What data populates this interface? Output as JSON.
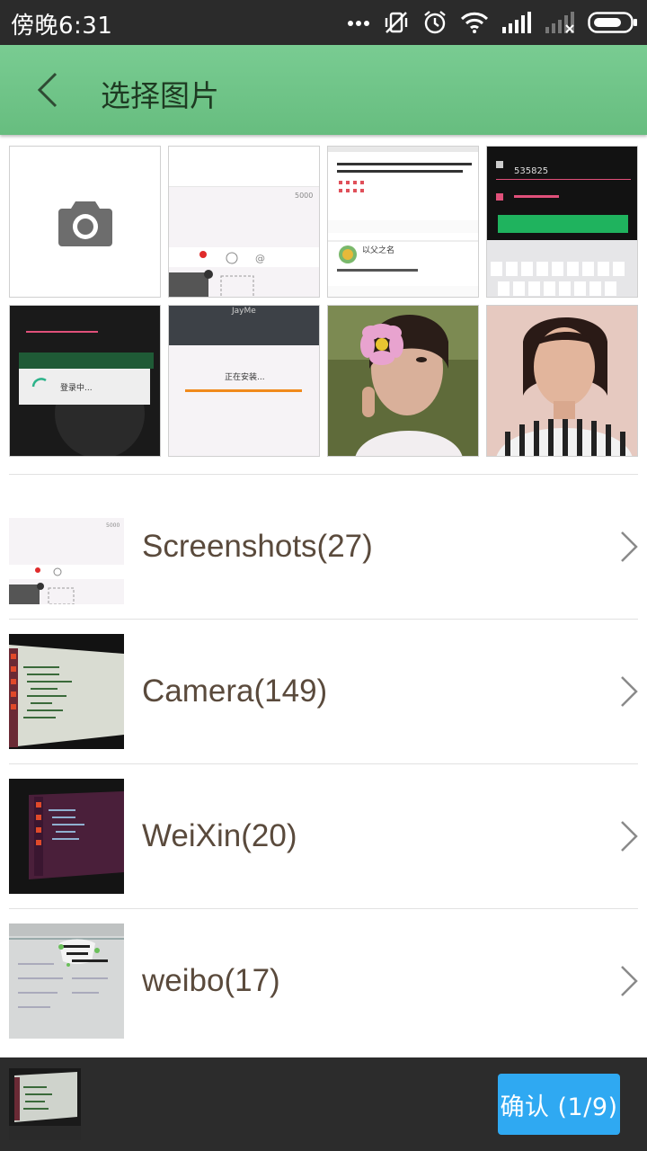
{
  "status_bar": {
    "time": "傍晚6:31",
    "icons": [
      "more-dots-icon",
      "vibrate-off-icon",
      "alarm-icon",
      "wifi-icon",
      "signal-icon",
      "signal-off-icon",
      "battery-icon"
    ]
  },
  "header": {
    "title": "选择图片",
    "back_icon": "chevron-left-icon",
    "background": "#6dc287"
  },
  "grid": {
    "camera_icon": "camera-icon",
    "thumbnails": [
      {
        "kind": "screenshot-compose",
        "text": "5000"
      },
      {
        "kind": "screenshot-feed",
        "text": "以父之名"
      },
      {
        "kind": "screenshot-keyboard",
        "text": "535825"
      },
      {
        "kind": "screenshot-loading",
        "text": "登录中..."
      },
      {
        "kind": "screenshot-install",
        "text": "正在安装...",
        "header": "JayMe"
      },
      {
        "kind": "photo-flower"
      },
      {
        "kind": "photo-portrait"
      }
    ]
  },
  "albums": [
    {
      "name": "Screenshots(27)"
    },
    {
      "name": "Camera(149)"
    },
    {
      "name": "WeiXin(20)"
    },
    {
      "name": "weibo(17)"
    }
  ],
  "bottom": {
    "confirm_label": "确认 (1/9)",
    "accent": "#2fa9f2"
  }
}
